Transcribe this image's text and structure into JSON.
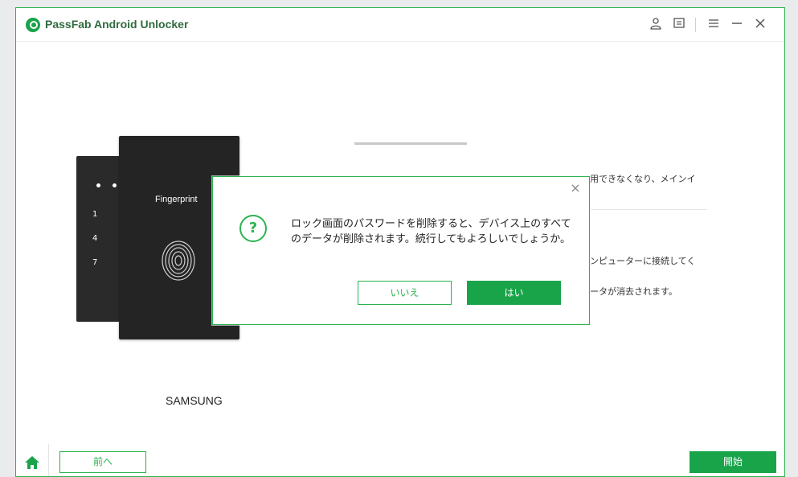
{
  "app": {
    "title": "PassFab Android Unlocker"
  },
  "titlebar": {
    "icons": [
      "user-icon",
      "feedback-icon",
      "menu-icon",
      "minimize-icon",
      "close-icon"
    ]
  },
  "device": {
    "fingerprint_label": "Fingerprint",
    "keypad_numbers": [
      "1",
      "4",
      "7"
    ],
    "brand": "SAMSUNG"
  },
  "background_text": {
    "line1": "用できなくなり、メインイ",
    "line2": "ンピューターに接続してく",
    "line3": "ータが消去されます。"
  },
  "dialog": {
    "message": "ロック画面のパスワードを削除すると、デバイス上のすべてのデータが削除されます。続行してもよろしいでしょうか。",
    "no_label": "いいえ",
    "yes_label": "はい"
  },
  "footer": {
    "back_label": "前へ",
    "start_label": "開始"
  },
  "colors": {
    "accent": "#19a44a",
    "border": "#2bb34f"
  }
}
